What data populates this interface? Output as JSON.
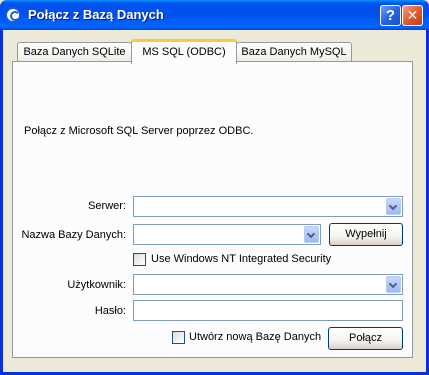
{
  "window": {
    "title": "Połącz z Bazą Danych",
    "help_label": "?",
    "close_label": "✕"
  },
  "tabs": [
    {
      "label": "Baza Danych SQLite",
      "active": false
    },
    {
      "label": "MS SQL (ODBC)",
      "active": true
    },
    {
      "label": "Baza Danych MySQL",
      "active": false
    }
  ],
  "panel": {
    "info_text": "Połącz z Microsoft SQL Server poprzez ODBC.",
    "server_label": "Serwer:",
    "server_value": "",
    "database_label": "Nazwa Bazy Danych:",
    "database_value": "",
    "fill_button": "Wypełnij",
    "windows_auth_label": "Use Windows NT Integrated Security",
    "windows_auth_checked": false,
    "user_label": "Użytkownik:",
    "user_value": "",
    "password_label": "Hasło:",
    "password_value": "",
    "create_db_label": "Utwórz nową Bazę Danych",
    "create_db_checked": false,
    "connect_button": "Połącz"
  },
  "colors": {
    "titlebar": "#0053ee",
    "dialog_bg": "#ece9d8",
    "panel_bg": "#fcfcfe",
    "active_tab_accent": "#ffc83c",
    "field_border": "#7f9db9"
  }
}
